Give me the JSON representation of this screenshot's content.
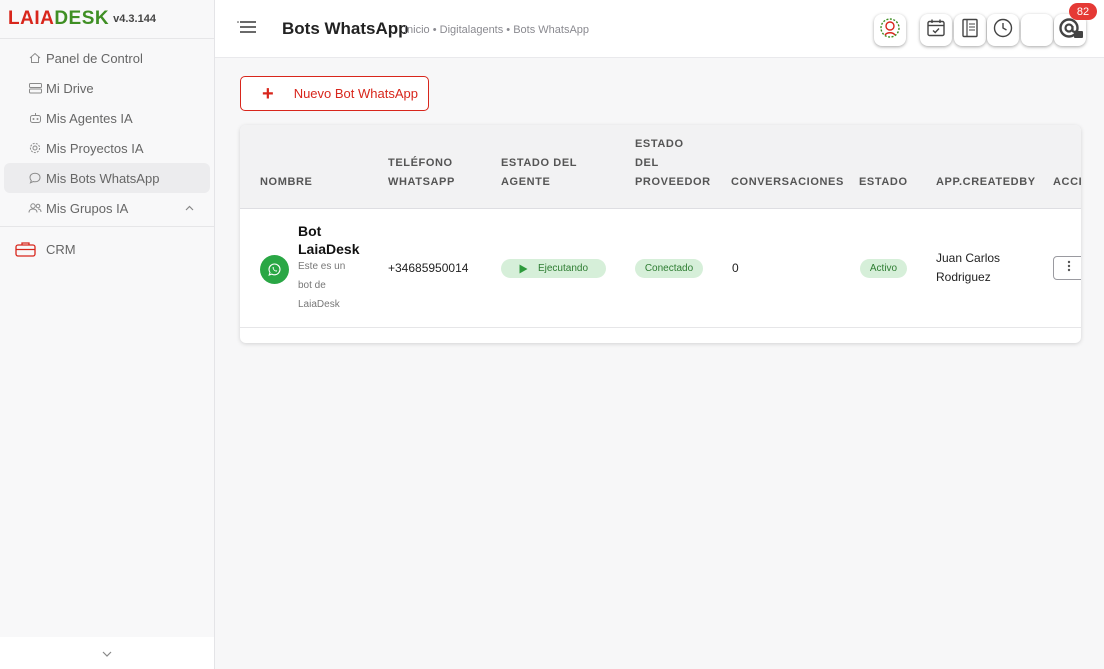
{
  "app": {
    "logo_part1": "LAIA",
    "logo_part2": "DESK",
    "version": "v4.3.144"
  },
  "sidebar": {
    "items": [
      {
        "label": "Panel de Control",
        "icon": "home-icon"
      },
      {
        "label": "Mi Drive",
        "icon": "drive-icon"
      },
      {
        "label": "Mis Agentes IA",
        "icon": "robot-icon"
      },
      {
        "label": "Mis Proyectos IA",
        "icon": "gear-icon"
      },
      {
        "label": "Mis Bots WhatsApp",
        "icon": "chat-icon",
        "active": true
      },
      {
        "label": "Mis Grupos IA",
        "icon": "users-icon",
        "expandable": true
      }
    ],
    "crm_label": "CRM"
  },
  "header": {
    "title": "Bots WhatsApp",
    "breadcrumb": "Inicio • Digitalagents • Bots WhatsApp",
    "notification_count": "82"
  },
  "toolbar": {
    "new_bot_label": "Nuevo Bot WhatsApp"
  },
  "table": {
    "headers": {
      "name": "NOMBRE",
      "phone_l1": "TELÉFONO",
      "phone_l2": "WHATSAPP",
      "agent_l1": "ESTADO DEL",
      "agent_l2": "AGENTE",
      "provider_l1": "ESTADO",
      "provider_l2": "DEL",
      "provider_l3": "PROVEEDOR",
      "conversations": "CONVERSACIONES",
      "status": "ESTADO",
      "created_by": "APP.CREATEDBY",
      "actions": "ACCIONES"
    },
    "rows": [
      {
        "name_l1": "Bot",
        "name_l2": "LaiaDesk",
        "desc_l1": "Este es un",
        "desc_l2": "bot de",
        "desc_l3": "LaiaDesk",
        "phone": "+34685950014",
        "agent_status": "Ejecutando",
        "provider_status": "Conectado",
        "conversations": "0",
        "status": "Activo",
        "created_by_l1": "Juan Carlos",
        "created_by_l2": "Rodriguez"
      }
    ]
  },
  "colors": {
    "brand_red": "#d8261c",
    "brand_green": "#3f8f24",
    "whatsapp_green": "#2aa745",
    "status_bg": "#d6efd9",
    "status_text": "#2e7d32",
    "badge_red": "#e53935"
  }
}
